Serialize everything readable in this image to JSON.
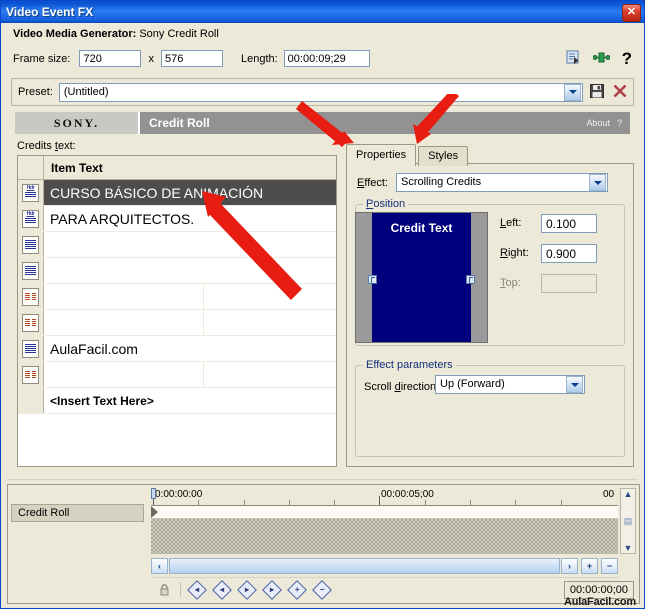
{
  "window": {
    "title": "Video Event FX",
    "close_label": "✕"
  },
  "header": {
    "generator_label": "Video Media Generator:",
    "generator_value": "Sony Credit Roll",
    "frame_size_label": "Frame size:",
    "frame_width": "720",
    "frame_x": "x",
    "frame_height": "576",
    "length_label": "Length:",
    "length_value": "00:00:09;29",
    "icons": [
      "plugin-chain-icon",
      "animate-icon",
      "help-icon"
    ],
    "help_glyph": "?"
  },
  "preset": {
    "label": "Preset:",
    "value": "(Untitled)",
    "save_title": "save-preset",
    "delete_title": "delete-preset"
  },
  "banner": {
    "brand": "SONY.",
    "title": "Credit Roll",
    "about": "About",
    "help": "?"
  },
  "credits": {
    "label": "Credits text:",
    "column_header": "Item Text",
    "rows": [
      {
        "icon": "header-row-icon",
        "type": "hdr",
        "text": "CURSO BÁSICO DE ANIMACIÓN",
        "selected": true,
        "two_col": false
      },
      {
        "icon": "header-row-icon",
        "type": "hdr",
        "text": "PARA ARQUITECTOS.",
        "selected": false,
        "two_col": false
      },
      {
        "icon": "single-column-row-icon",
        "type": "single",
        "text": "",
        "selected": false,
        "two_col": false
      },
      {
        "icon": "single-column-row-icon",
        "type": "single",
        "text": "",
        "selected": false,
        "two_col": false
      },
      {
        "icon": "dual-column-row-icon",
        "type": "dual",
        "text": "",
        "text2": "",
        "selected": false,
        "two_col": true
      },
      {
        "icon": "dual-column-row-icon",
        "type": "dual",
        "text": "",
        "text2": "",
        "selected": false,
        "two_col": true
      },
      {
        "icon": "single-column-row-icon",
        "type": "single",
        "text": "AulaFacil.com",
        "selected": false,
        "two_col": false
      },
      {
        "icon": "dual-column-row-icon",
        "type": "dual",
        "text": "",
        "text2": "",
        "selected": false,
        "two_col": true
      },
      {
        "icon": "",
        "type": "insert",
        "text": "<Insert Text Here>",
        "selected": false,
        "two_col": false
      }
    ]
  },
  "tabs": [
    {
      "label": "Properties",
      "active": true
    },
    {
      "label": "Styles",
      "active": false
    }
  ],
  "properties": {
    "effect_label": "Effect:",
    "effect_value": "Scrolling Credits",
    "position_group": "Position",
    "preview_text": "Credit Text",
    "left_label": "Left:",
    "left_value": "0.100",
    "right_label": "Right:",
    "right_value": "0.900",
    "top_label": "Top:",
    "top_value": "",
    "effect_params_group": "Effect parameters",
    "scroll_dir_label": "Scroll direction:",
    "scroll_dir_value": "Up (Forward)"
  },
  "timeline": {
    "track_label": "Credit Roll",
    "ruler_labels": [
      "0:00:00:00",
      "00:00:05;00",
      "00"
    ],
    "timecode": "00:00:00;00",
    "lock_icon": "lock-keyframes-icon",
    "keyframe_buttons": [
      "first-keyframe-button",
      "previous-keyframe-button",
      "next-keyframe-button",
      "last-keyframe-button",
      "add-keyframe-button",
      "remove-keyframe-button"
    ],
    "scroll_left": "‹",
    "scroll_right": "›",
    "zoom_in": "+",
    "zoom_out": "−",
    "scroll_up": "▲",
    "scroll_down": "▼"
  },
  "watermark": "AulaFacil.com",
  "colors": {
    "titlebar": "#1560dd",
    "face": "#ece9d8",
    "selection": "#4d4d4d",
    "preview_bg": "#00007c",
    "group_label": "#15317e",
    "arrow": "#e81c10"
  }
}
